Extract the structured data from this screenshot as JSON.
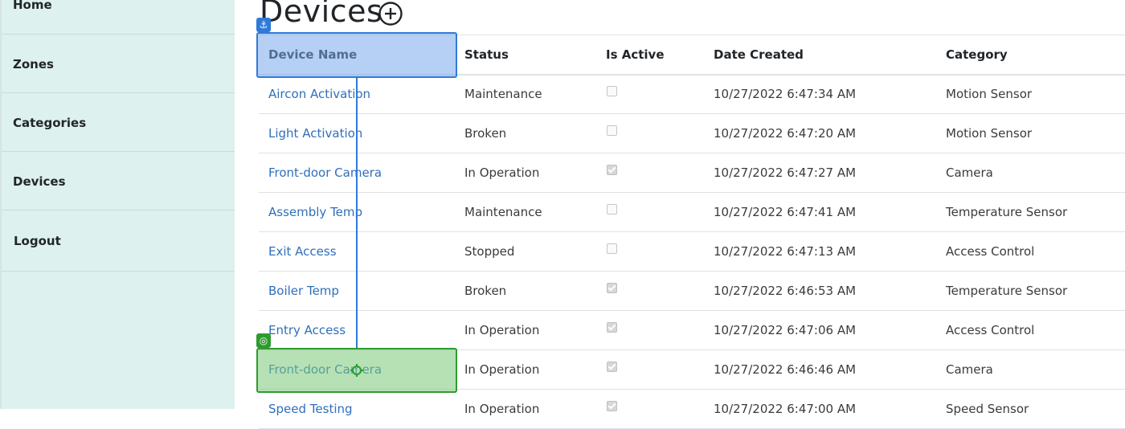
{
  "sidebar": {
    "items": [
      {
        "label": "Home"
      },
      {
        "label": "Zones"
      },
      {
        "label": "Categories"
      },
      {
        "label": "Devices"
      },
      {
        "label": "Logout"
      }
    ]
  },
  "page": {
    "title": "Devices"
  },
  "table": {
    "headers": [
      "Device Name",
      "Status",
      "Is Active",
      "Date Created",
      "Category"
    ],
    "rows": [
      {
        "name": "Aircon Activation",
        "status": "Maintenance",
        "active": false,
        "date": "10/27/2022 6:47:34 AM",
        "category": "Motion Sensor"
      },
      {
        "name": "Light Activation",
        "status": "Broken",
        "active": false,
        "date": "10/27/2022 6:47:20 AM",
        "category": "Motion Sensor"
      },
      {
        "name": "Front-door Camera",
        "status": "In Operation",
        "active": true,
        "date": "10/27/2022 6:47:27 AM",
        "category": "Camera"
      },
      {
        "name": "Assembly Temp",
        "status": "Maintenance",
        "active": false,
        "date": "10/27/2022 6:47:41 AM",
        "category": "Temperature Sensor"
      },
      {
        "name": "Exit Access",
        "status": "Stopped",
        "active": false,
        "date": "10/27/2022 6:47:13 AM",
        "category": "Access Control"
      },
      {
        "name": "Boiler Temp",
        "status": "Broken",
        "active": true,
        "date": "10/27/2022 6:46:53 AM",
        "category": "Temperature Sensor"
      },
      {
        "name": "Entry Access",
        "status": "In Operation",
        "active": true,
        "date": "10/27/2022 6:47:06 AM",
        "category": "Access Control"
      },
      {
        "name": "Front-door Camera",
        "status": "In Operation",
        "active": true,
        "date": "10/27/2022 6:46:46 AM",
        "category": "Camera"
      },
      {
        "name": "Speed Testing",
        "status": "In Operation",
        "active": true,
        "date": "10/27/2022 6:47:00 AM",
        "category": "Speed Sensor"
      }
    ]
  },
  "colors": {
    "sidebar_bg": "#ddf1ef",
    "link": "#2f6fbb",
    "source_highlight": "#2f7ad8",
    "target_highlight": "#2e9b2e"
  },
  "icons": {
    "add": "plus-circle-icon",
    "source_badge": "anchor-icon",
    "target_badge": "target-icon",
    "drop_marker": "crosshair-icon"
  }
}
